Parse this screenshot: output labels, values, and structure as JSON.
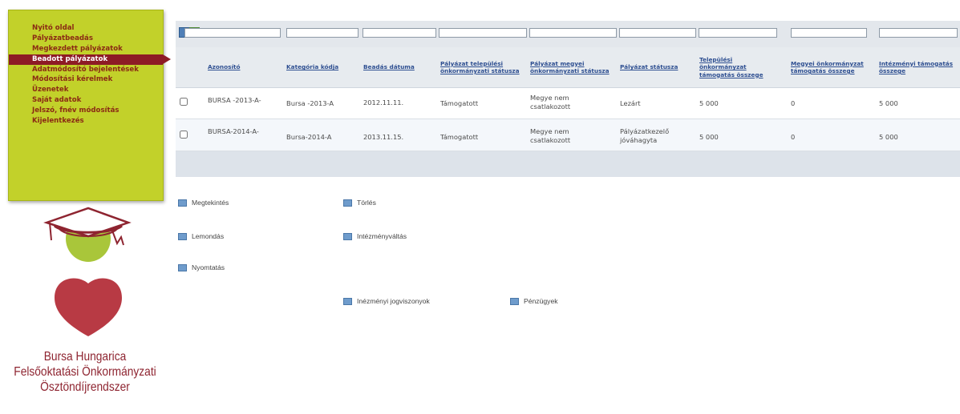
{
  "nav": {
    "items": [
      {
        "label": "Nyitó oldal",
        "active": false
      },
      {
        "label": "Pályázatbeadás",
        "active": false
      },
      {
        "label": "Megkezdett pályázatok",
        "active": false
      },
      {
        "label": "Beadott pályázatok",
        "active": true
      },
      {
        "label": "Adatmódosító bejelentések",
        "active": false
      },
      {
        "label": "Módosítási kérelmek",
        "active": false
      },
      {
        "label": "Üzenetek",
        "active": false
      },
      {
        "label": "Saját adatok",
        "active": false
      },
      {
        "label": "Jelszó, fnév módosítás",
        "active": false
      },
      {
        "label": "Kijelentkezés",
        "active": false
      }
    ]
  },
  "logo": {
    "line1": "Bursa Hungarica",
    "line2": "Felsőoktatási Önkormányzati",
    "line3": "Ösztöndíjrendszer",
    "colors": {
      "hat": "#8e2430",
      "green": "#a9c63a",
      "heart": "#b83a44"
    }
  },
  "toolbar": {
    "icons": [
      "refresh-icon",
      "excel-export-icon"
    ]
  },
  "grid": {
    "columns": [
      {
        "label": "Azonosító"
      },
      {
        "label": "Kategória kódja"
      },
      {
        "label": "Beadás dátuma"
      },
      {
        "label": "Pályázat települési önkormányzati státusza"
      },
      {
        "label": "Pályázat megyei önkormányzati státusza"
      },
      {
        "label": "Pályázat státusza"
      },
      {
        "label": "Települési önkormányzat támogatás összege"
      },
      {
        "label": "Megyei önkormányzat támogatás összege"
      },
      {
        "label": "Intézményi támogatás összege"
      }
    ],
    "rows": [
      {
        "checked": false,
        "cells": [
          "BURSA -2013-A-",
          "Bursa -2013-A",
          "2012.11.11.",
          "Támogatott",
          "Megye nem csatlakozott",
          "Lezárt",
          "5 000",
          "0",
          "5 000"
        ]
      },
      {
        "checked": false,
        "cells": [
          "BURSA-2014-A-",
          "Bursa-2014-A",
          "2013.11.15.",
          "Támogatott",
          "Megye nem csatlakozott",
          "Pályázatkezelő jóváhagyta",
          "5 000",
          "0",
          "5 000"
        ]
      }
    ]
  },
  "actions": [
    {
      "label": "Megtekintés"
    },
    {
      "label": "Törlés"
    },
    {
      "label": "Lemondás"
    },
    {
      "label": "Intézményváltás"
    },
    {
      "label": "Nyomtatás"
    },
    {
      "label": "Inézményi jogviszonyok"
    },
    {
      "label": "Pénzügyek"
    }
  ],
  "colors": {
    "sidebar": "#c2d12a",
    "nav_text": "#8a2a14",
    "nav_active": "#8d1b25",
    "header_link": "#2e4f91"
  }
}
